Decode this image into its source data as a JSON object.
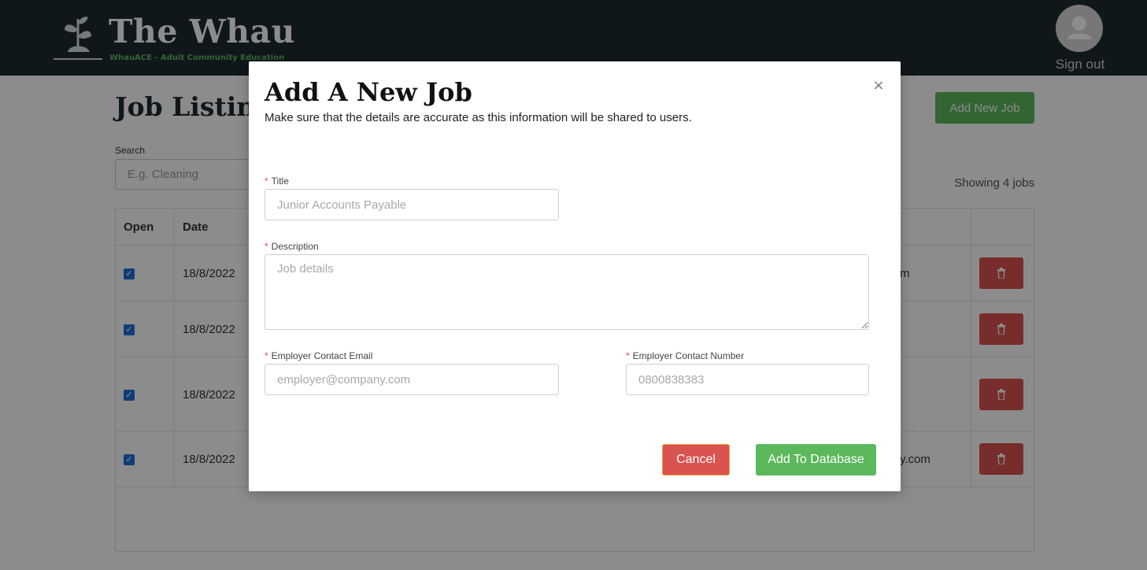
{
  "header": {
    "brand_title": "The Whau",
    "brand_subtitle": "WhauACE - Adult Community Education",
    "signout_label": "Sign out"
  },
  "page": {
    "title": "Job Listings",
    "add_new_label": "Add New Job",
    "search_label": "Search",
    "search_placeholder": "E.g. Cleaning",
    "showing_text": "Showing 4 jobs"
  },
  "table": {
    "columns": [
      "Open",
      "Date"
    ],
    "rows": [
      {
        "date": "18/8/2022",
        "tail": "m"
      },
      {
        "date": "18/8/2022",
        "tail": ""
      },
      {
        "date": "18/8/2022",
        "tail": ""
      },
      {
        "date": "18/8/2022",
        "tail": "y.com"
      }
    ]
  },
  "modal": {
    "title": "Add A New Job",
    "subtitle": "Make sure that the details are accurate as this information will be shared to users.",
    "close_glyph": "×",
    "fields": {
      "title_label": "Title",
      "title_placeholder": "Junior Accounts Payable",
      "description_label": "Description",
      "description_placeholder": "Job details",
      "email_label": "Employer Contact Email",
      "email_placeholder": "employer@company.com",
      "phone_label": "Employer Contact Number",
      "phone_placeholder": "0800838383"
    },
    "required_mark": "*",
    "cancel_label": "Cancel",
    "submit_label": "Add To Database"
  },
  "colors": {
    "header_bg": "#1e2a32",
    "primary_green": "#5cb85c",
    "danger_red": "#d9534f",
    "checkbox_blue": "#1e6fd9"
  }
}
